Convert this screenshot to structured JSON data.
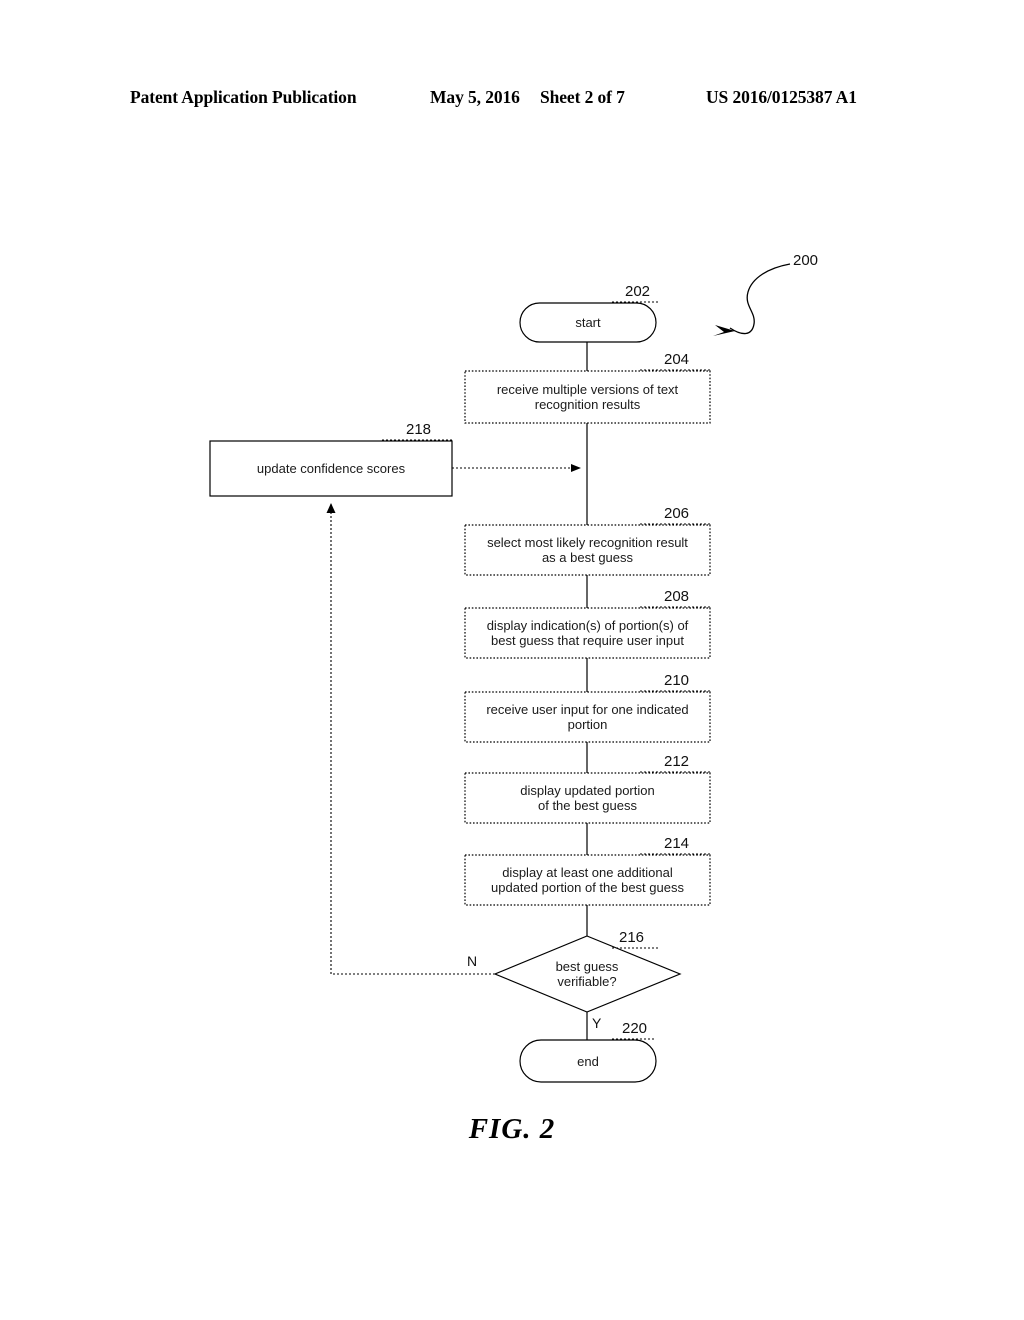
{
  "header": {
    "publication": "Patent Application Publication",
    "date": "May 5, 2016",
    "sheet": "Sheet 2 of 7",
    "patent_number": "US 2016/0125387 A1"
  },
  "figure": {
    "caption": "FIG. 2",
    "diagram_ref": "200"
  },
  "flowchart": {
    "nodes": [
      {
        "id": "start",
        "ref": "202",
        "shape": "terminator",
        "border": "solid",
        "label": "start"
      },
      {
        "id": "receive-versions",
        "ref": "204",
        "shape": "process",
        "border": "dotted",
        "label": "receive multiple versions of text\nrecognition results"
      },
      {
        "id": "update-confidence",
        "ref": "218",
        "shape": "process",
        "border": "solid",
        "label": "update confidence scores"
      },
      {
        "id": "select-best-guess",
        "ref": "206",
        "shape": "process",
        "border": "dotted",
        "label": "select most likely recognition result\nas a best guess"
      },
      {
        "id": "display-indications",
        "ref": "208",
        "shape": "process",
        "border": "dotted",
        "label": "display indication(s) of portion(s) of\nbest guess that require user input"
      },
      {
        "id": "receive-user-input",
        "ref": "210",
        "shape": "process",
        "border": "dotted",
        "label": "receive user input for one indicated\nportion"
      },
      {
        "id": "display-updated-portion",
        "ref": "212",
        "shape": "process",
        "border": "dotted",
        "label": "display updated portion\nof the best guess"
      },
      {
        "id": "display-additional-portion",
        "ref": "214",
        "shape": "process",
        "border": "dotted",
        "label": "display at least one additional\nupdated portion of the best guess"
      },
      {
        "id": "verify-decision",
        "ref": "216",
        "shape": "decision",
        "border": "solid",
        "label": "best guess\nverifiable?"
      },
      {
        "id": "end",
        "ref": "220",
        "shape": "terminator",
        "border": "solid",
        "label": "end"
      }
    ],
    "branches": {
      "no_label": "N",
      "yes_label": "Y"
    }
  }
}
